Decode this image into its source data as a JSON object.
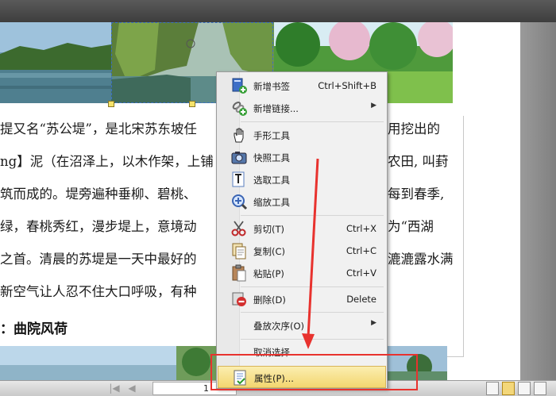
{
  "document": {
    "lines": [
      "提又名“苏公堤”，是北宋苏东坡任",
      "ng】泥（在沼泽上，以木作架，上铺",
      "筑而成的。堤旁遍种垂柳、碧桃、",
      "绿，春桃秀红，漫步堤上，意境动",
      "之首。清晨的苏堤是一天中最好的",
      "新空气让人忍不住大口呼吸，有种"
    ],
    "right_fragments": [
      "用挖出的",
      "农田, 叫葑",
      "每到春季,",
      "为“西湖",
      "漉漉露水满"
    ],
    "heading": "：曲院风荷"
  },
  "context_menu": {
    "items": [
      {
        "label": "新增书签",
        "shortcut": "Ctrl+Shift+B",
        "icon": "bookmark-add-icon"
      },
      {
        "label": "新增链接...",
        "submenu": true,
        "icon": "link-add-icon"
      },
      {
        "label": "手形工具",
        "icon": "hand-tool-icon"
      },
      {
        "label": "快照工具",
        "icon": "camera-icon"
      },
      {
        "label": "选取工具",
        "icon": "text-select-icon"
      },
      {
        "label": "缩放工具",
        "icon": "zoom-icon"
      },
      {
        "label": "剪切(T)",
        "shortcut": "Ctrl+X",
        "icon": "scissors-icon"
      },
      {
        "label": "复制(C)",
        "shortcut": "Ctrl+C",
        "icon": "copy-icon"
      },
      {
        "label": "粘贴(P)",
        "shortcut": "Ctrl+V",
        "icon": "paste-icon"
      },
      {
        "label": "删除(D)",
        "shortcut": "Delete",
        "icon": "delete-icon"
      },
      {
        "label": "叠放次序(O)",
        "submenu": true
      },
      {
        "label": "取消选择"
      },
      {
        "label": "属性(P)...",
        "icon": "properties-icon",
        "highlighted": true
      }
    ],
    "submenu_arrow": "▶"
  },
  "status_bar": {
    "page_number": "1"
  },
  "colors": {
    "annotation_red": "#e8322e",
    "highlight": "#f3d66f"
  }
}
